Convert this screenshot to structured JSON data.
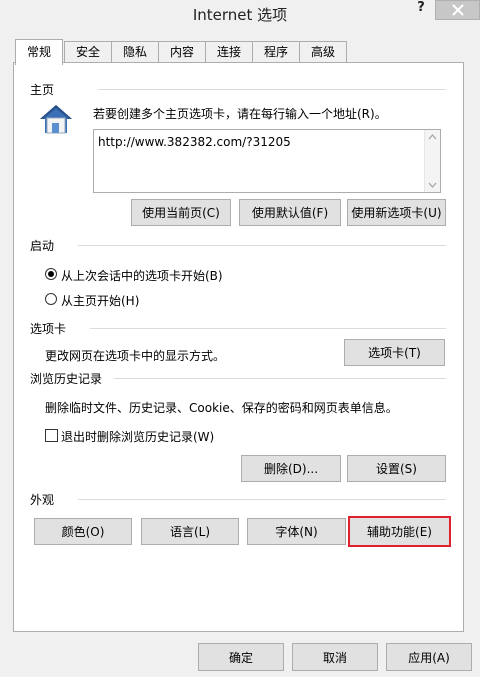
{
  "window": {
    "title": "Internet 选项",
    "help_label": "?"
  },
  "tabs": [
    {
      "label": "常规",
      "active": true
    },
    {
      "label": "安全",
      "active": false
    },
    {
      "label": "隐私",
      "active": false
    },
    {
      "label": "内容",
      "active": false
    },
    {
      "label": "连接",
      "active": false
    },
    {
      "label": "程序",
      "active": false
    },
    {
      "label": "高级",
      "active": false
    }
  ],
  "home": {
    "title": "主页",
    "description": "若要创建多个主页选项卡，请在每行输入一个地址(R)。",
    "url_value": "http://www.382382.com/?31205",
    "buttons": {
      "use_current": "使用当前页(C)",
      "use_default": "使用默认值(F)",
      "use_new_tab": "使用新选项卡(U)"
    }
  },
  "startup": {
    "title": "启动",
    "options": [
      {
        "label": "从上次会话中的选项卡开始(B)",
        "checked": true
      },
      {
        "label": "从主页开始(H)",
        "checked": false
      }
    ]
  },
  "tabs_section": {
    "title": "选项卡",
    "description": "更改网页在选项卡中的显示方式。",
    "button": "选项卡(T)"
  },
  "history": {
    "title": "浏览历史记录",
    "description": "删除临时文件、历史记录、Cookie、保存的密码和网页表单信息。",
    "checkbox_label": "退出时删除浏览历史记录(W)",
    "checkbox_checked": false,
    "delete_button": "删除(D)...",
    "settings_button": "设置(S)"
  },
  "appearance": {
    "title": "外观",
    "buttons": {
      "colors": "颜色(O)",
      "languages": "语言(L)",
      "fonts": "字体(N)",
      "accessibility": "辅助功能(E)"
    }
  },
  "footer": {
    "ok": "确定",
    "cancel": "取消",
    "apply": "应用(A)"
  },
  "colors": {
    "highlight_border": "#e0202c",
    "house_roof": "#3a6fb5"
  }
}
